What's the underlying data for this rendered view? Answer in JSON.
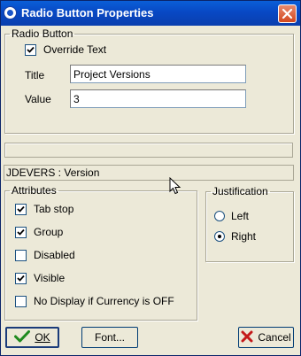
{
  "window": {
    "title": "Radio Button Properties"
  },
  "radio_button_group": {
    "legend": "Radio Button",
    "override_text": {
      "label": "Override Text",
      "checked": true
    },
    "title": {
      "label": "Title",
      "value": "Project Versions"
    },
    "value": {
      "label": "Value",
      "value": "3"
    }
  },
  "status_text": "JDEVERS : Version",
  "attributes": {
    "legend": "Attributes",
    "items": [
      {
        "label": "Tab stop",
        "checked": true
      },
      {
        "label": "Group",
        "checked": true
      },
      {
        "label": "Disabled",
        "checked": false
      },
      {
        "label": "Visible",
        "checked": true
      },
      {
        "label": "No Display if Currency is OFF",
        "checked": false
      }
    ]
  },
  "justification": {
    "legend": "Justification",
    "options": [
      {
        "label": "Left",
        "selected": false
      },
      {
        "label": "Right",
        "selected": true
      }
    ]
  },
  "buttons": {
    "ok_label": "OK",
    "font_label": "Font...",
    "cancel_label": "Cancel"
  },
  "icons": [
    "app-icon",
    "close-icon",
    "checkmark-icon",
    "cancel-x-icon",
    "mouse-pointer-icon"
  ]
}
